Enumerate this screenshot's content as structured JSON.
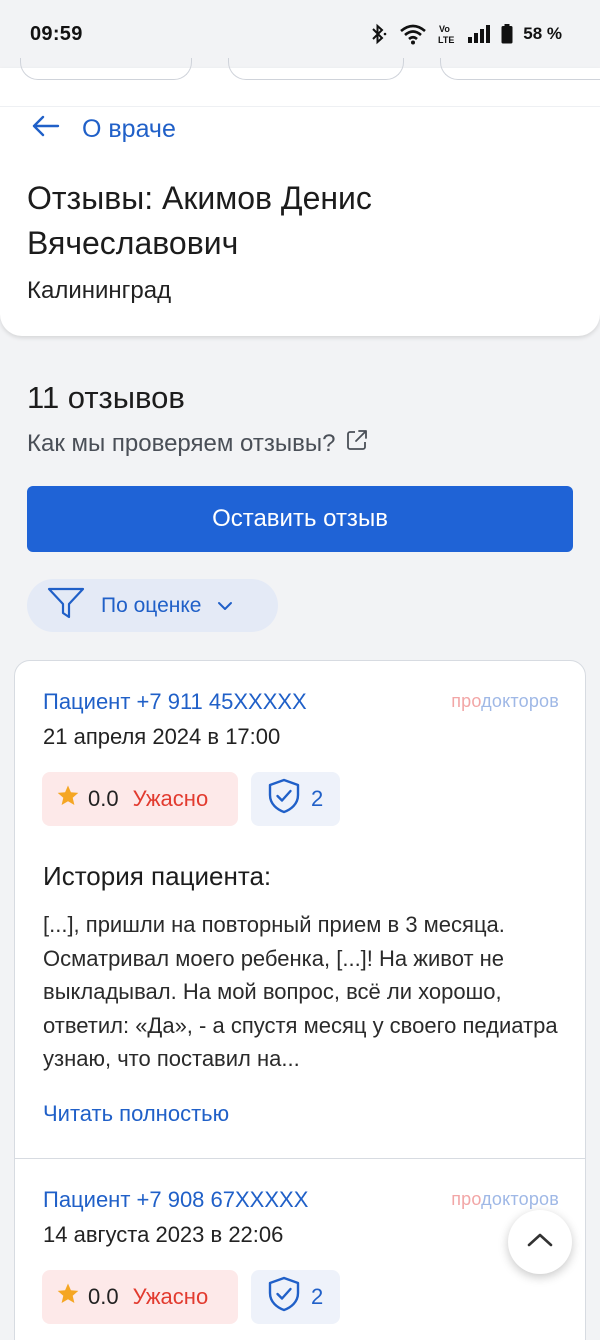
{
  "status_bar": {
    "time": "09:59",
    "battery": "58 %",
    "icons": [
      "bluetooth-icon",
      "wifi-icon",
      "volte-icon",
      "signal-icon",
      "battery-icon"
    ]
  },
  "header": {
    "back_label": "О враче",
    "title": "Отзывы: Акимов Денис Вячеславович",
    "city": "Калининград"
  },
  "reviews_section": {
    "count": "11 отзывов",
    "how_we_check": "Как мы проверяем отзывы?",
    "leave_button": "Оставить отзыв",
    "filter_label": "По оценке"
  },
  "colors": {
    "accent": "#1f63d6",
    "link": "#2060c8",
    "bad_rating": "#e23b2f"
  },
  "reviews": [
    {
      "author": "Пациент +7 911 45XXXXX",
      "source_a": "про",
      "source_b": "докторов",
      "date": "21 апреля 2024 в 17:00",
      "rating": "0.0",
      "rating_label": "Ужасно",
      "verified_count": "2",
      "story_title": "История пациента:",
      "story_text": "[...], пришли на повторный прием в 3 месяца. Осматривал моего ребенка, [...]! На живот не выкладывал. На мой вопрос, всё ли хорошо, ответил: «Да», - а спустя месяц у своего педиатра узнаю, что поставил на...",
      "read_more": "Читать полностью"
    },
    {
      "author": "Пациент +7 908 67XXXXX",
      "source_a": "про",
      "source_b": "докторов",
      "date": "14 августа 2023 в 22:06",
      "rating": "0.0",
      "rating_label": "Ужасно",
      "verified_count": "2"
    }
  ]
}
